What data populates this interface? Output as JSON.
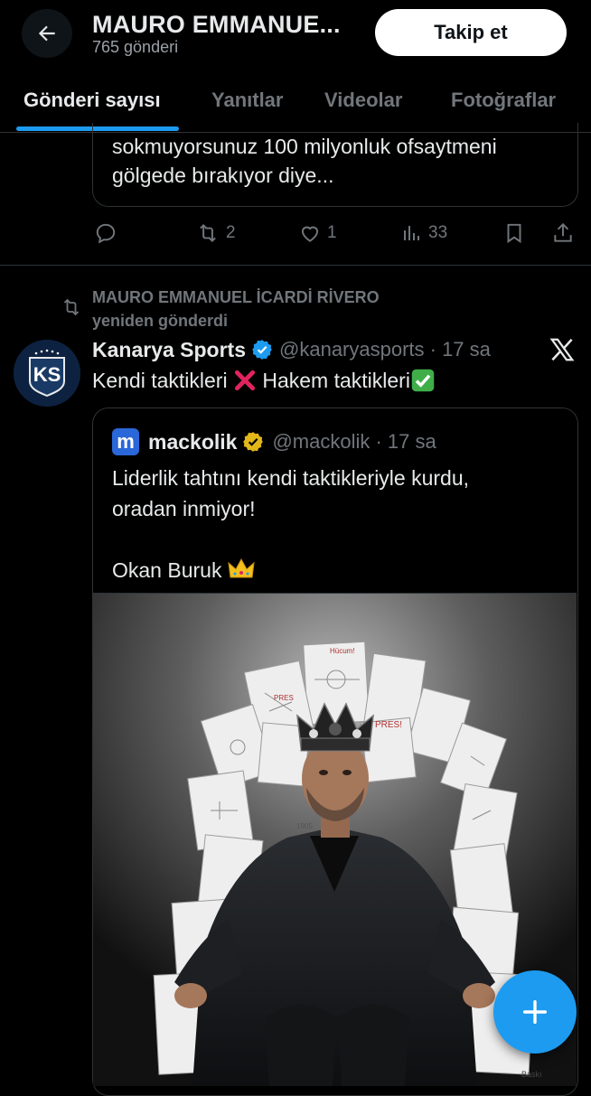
{
  "header": {
    "title": "MAURO EMMANUE...",
    "subtitle": "765 gönderi",
    "follow_label": "Takip et"
  },
  "tabs": [
    {
      "label": "Gönderi sayısı",
      "active": true
    },
    {
      "label": "Yanıtlar"
    },
    {
      "label": "Videolar"
    },
    {
      "label": "Fotoğraflar"
    }
  ],
  "prev_tweet": {
    "text_line1": "sokmuyorsunuz 100 milyonluk ofsaytmeni",
    "text_line2": "gölgede bırakıyor diye...",
    "retweets": "2",
    "likes": "1",
    "views": "33"
  },
  "retweet": {
    "by_line1": "MAURO EMMANUEL İCARDİ RİVERO",
    "by_line2": "yeniden gönderdi"
  },
  "tweet": {
    "name": "Kanarya Sports",
    "handle": "@kanaryasports · 17 sa",
    "text_a": "Kendi taktikleri ",
    "text_b": " Hakem taktikleri",
    "avatar_text": "KS"
  },
  "quote": {
    "logo_letter": "m",
    "name": "mackolik",
    "handle": "@mackolik · 17 sa",
    "line1": "Liderlik tahtını kendi taktikleriyle kurdu,",
    "line2": "oradan inmiyor!",
    "line3": "Okan Buruk"
  },
  "image_texts": {
    "paper1": "Hücum!",
    "paper2": "PRES!",
    "paper3": "PRES",
    "paper4": "1905",
    "paper5": "Baskı"
  },
  "colors": {
    "accent": "#1d9bf0",
    "background": "#000000",
    "muted": "#71767b"
  },
  "icons": [
    "arrow-left-icon",
    "reply-icon",
    "retweet-icon",
    "heart-icon",
    "views-icon",
    "bookmark-icon",
    "share-icon",
    "x-logo-icon",
    "verified-icon",
    "gold-verified-icon",
    "cross-emoji-icon",
    "check-emoji-icon",
    "crown-emoji-icon",
    "plus-icon"
  ]
}
